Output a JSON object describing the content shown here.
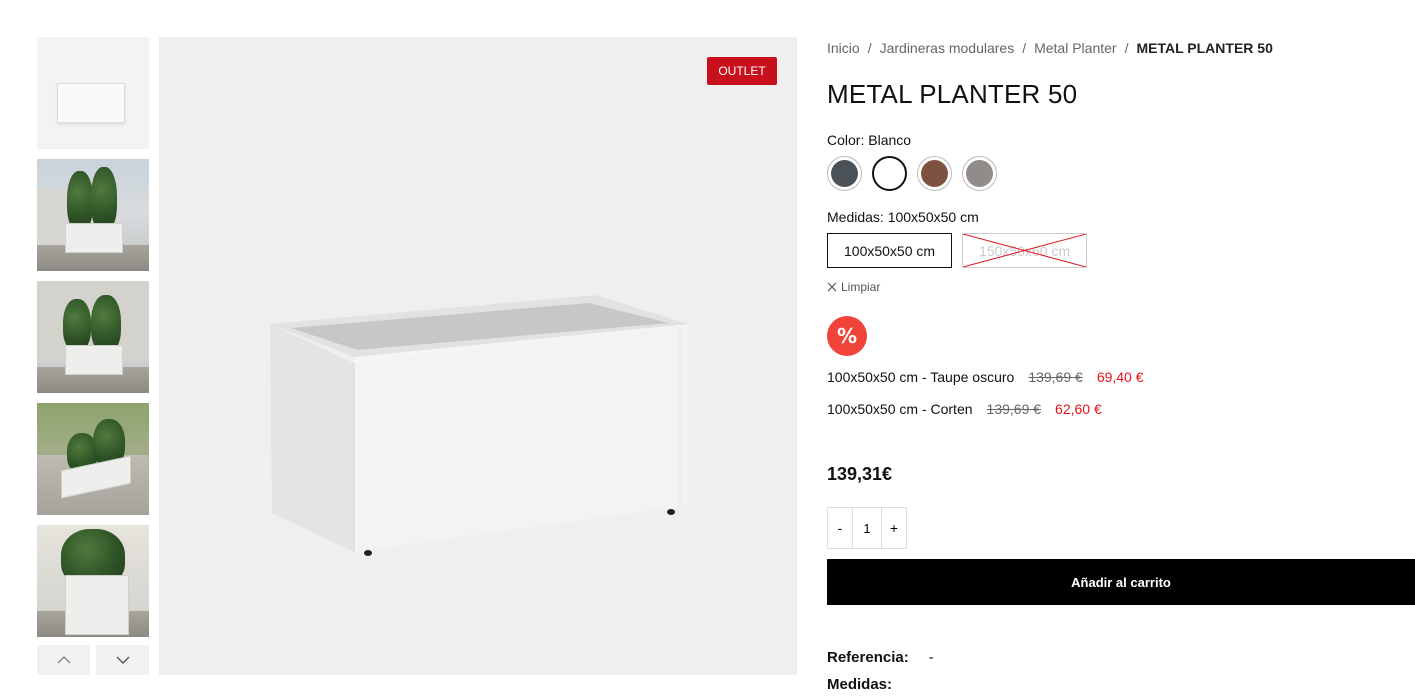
{
  "badge": "OUTLET",
  "breadcrumb": {
    "items": [
      "Inicio",
      "Jardineras modulares",
      "Metal Planter"
    ],
    "current": "METAL PLANTER 50",
    "separator": "/"
  },
  "product": {
    "title": "METAL PLANTER 50",
    "color_label": "Color:",
    "color_value": "Blanco",
    "swatches": [
      {
        "name": "Antracita",
        "color": "#4a5257"
      },
      {
        "name": "Blanco",
        "color": "#ffffff"
      },
      {
        "name": "Corten",
        "color": "#7d5240"
      },
      {
        "name": "Taupe oscuro",
        "color": "#918b89"
      }
    ],
    "size_label": "Medidas:",
    "size_value": "100x50x50 cm",
    "sizes": [
      "100x50x50 cm",
      "150x50x60 cm"
    ],
    "clear_label": "Limpiar",
    "discount_icon": "%",
    "offers": [
      {
        "label": "100x50x50 cm - Taupe oscuro",
        "old": "139,69 €",
        "new": "69,40 €"
      },
      {
        "label": "100x50x50 cm - Corten",
        "old": "139,69 €",
        "new": "62,60 €"
      }
    ],
    "price": "139,31€",
    "qty": {
      "minus": "-",
      "value": "1",
      "plus": "+"
    },
    "add_to_cart": "Añadir al carrito",
    "reference_label": "Referencia:",
    "reference_value": "-",
    "next_label": "Medidas:"
  },
  "thumb_nav": {
    "prev": "chevron-up-icon",
    "next": "chevron-down-icon"
  },
  "colors": {
    "badge": "#c8101c",
    "sale": "#e0121b",
    "discount_badge": "#f0443a",
    "cart_button": "#000000"
  }
}
